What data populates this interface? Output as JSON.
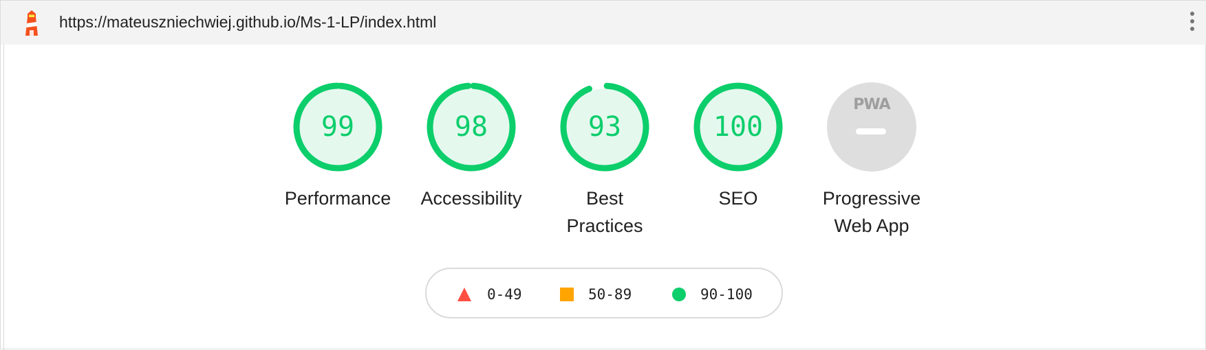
{
  "browser": {
    "url": "https://mateuszniechwiej.github.io/Ms-1-LP/index.html",
    "logo_icon": "lighthouse-icon",
    "menu_icon": "more-vert-icon"
  },
  "gauges": [
    {
      "label": "Performance",
      "score": "99",
      "value": 99
    },
    {
      "label": "Accessibility",
      "score": "98",
      "value": 98
    },
    {
      "label_line1": "Best",
      "label_line2": "Practices",
      "score": "93",
      "value": 93
    },
    {
      "label": "SEO",
      "score": "100",
      "value": 100
    }
  ],
  "pwa": {
    "badge": "PWA",
    "label_line1": "Progressive",
    "label_line2": "Web App"
  },
  "legend": [
    {
      "range": "0-49",
      "shape": "triangle",
      "color": "#ff4e42"
    },
    {
      "range": "50-89",
      "shape": "square",
      "color": "#ffa400"
    },
    {
      "range": "90-100",
      "shape": "circle",
      "color": "#0cce6b"
    }
  ],
  "colors": {
    "pass": "#0cce6b",
    "pass_bg": "#e5f8ee",
    "average": "#ffa400",
    "fail": "#ff4e42",
    "pwa_bg": "#dedede"
  }
}
